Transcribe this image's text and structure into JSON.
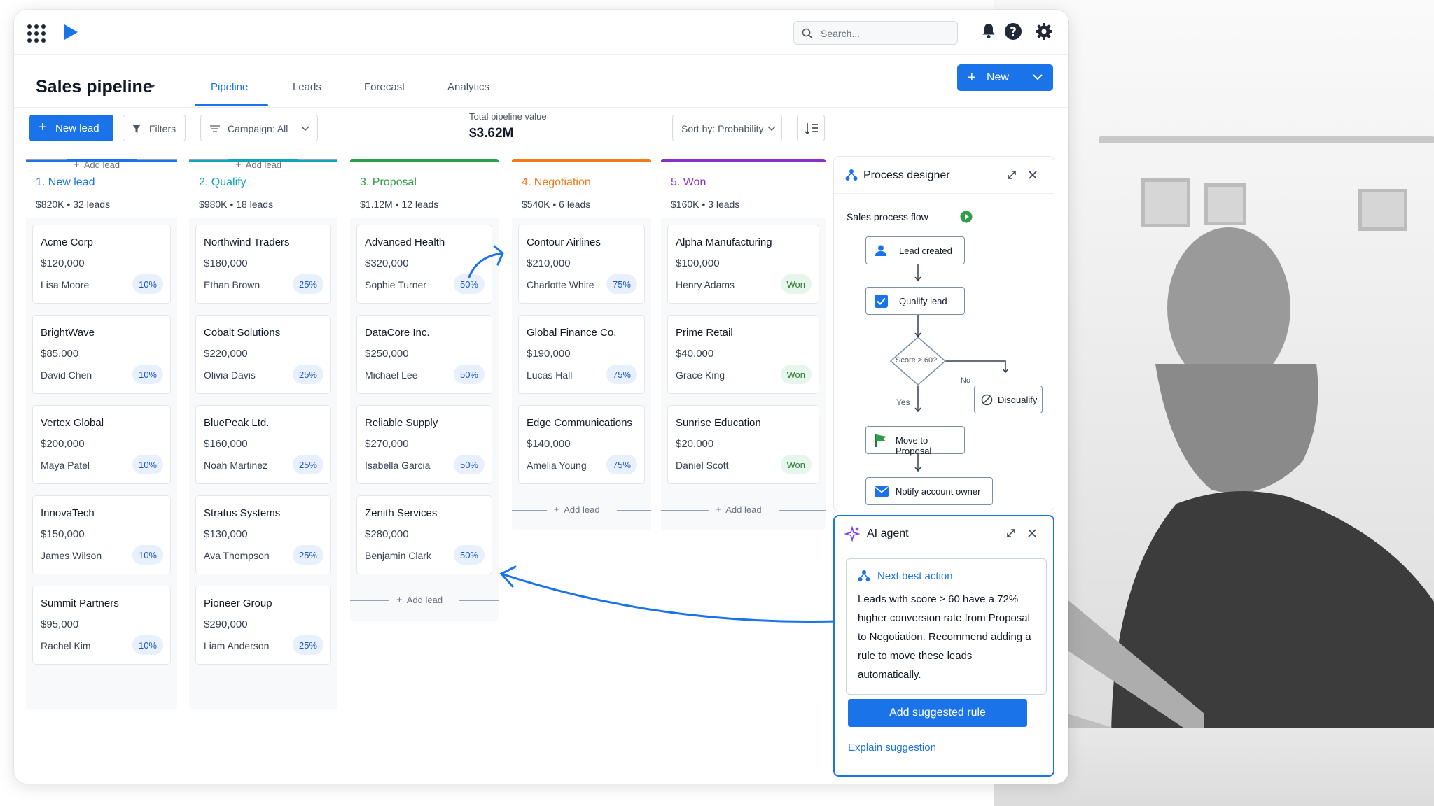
{
  "search": {
    "placeholder": "Search..."
  },
  "header": {
    "title": "Sales pipeline",
    "tabs": [
      {
        "label": "Pipeline",
        "active": true
      },
      {
        "label": "Leads",
        "active": false
      },
      {
        "label": "Forecast",
        "active": false
      },
      {
        "label": "Analytics",
        "active": false
      }
    ],
    "new_button": "New"
  },
  "toolbar": {
    "new_lead": "New lead",
    "filters": "Filters",
    "campaign": "Campaign: All",
    "total_label": "Total pipeline value",
    "total_value": "$3.62M",
    "sort": "Sort by: Probability"
  },
  "columns": [
    {
      "title": "1. New lead",
      "summary": "$820K • 32 leads",
      "color": "#1a73e8",
      "cards": [
        {
          "name": "Acme Corp",
          "value": "$120,000",
          "owner": "Lisa Moore",
          "badge": "10%"
        },
        {
          "name": "BrightWave",
          "value": "$85,000",
          "owner": "David Chen",
          "badge": "10%"
        },
        {
          "name": "Vertex Global",
          "value": "$200,000",
          "owner": "Maya Patel",
          "badge": "10%"
        },
        {
          "name": "InnovaTech",
          "value": "$150,000",
          "owner": "James Wilson",
          "badge": "10%"
        },
        {
          "name": "Summit Partners",
          "value": "$95,000",
          "owner": "Rachel Kim",
          "badge": "10%"
        }
      ],
      "add_label": "Add lead"
    },
    {
      "title": "2. Qualify",
      "summary": "$980K • 18 leads",
      "color": "#0ea5b7",
      "cards": [
        {
          "name": "Northwind Traders",
          "value": "$180,000",
          "owner": "Ethan Brown",
          "badge": "25%"
        },
        {
          "name": "Cobalt Solutions",
          "value": "$220,000",
          "owner": "Olivia Davis",
          "badge": "25%"
        },
        {
          "name": "BluePeak Ltd.",
          "value": "$160,000",
          "owner": "Noah Martinez",
          "badge": "25%"
        },
        {
          "name": "Stratus Systems",
          "value": "$130,000",
          "owner": "Ava Thompson",
          "badge": "25%"
        },
        {
          "name": "Pioneer Group",
          "value": "$290,000",
          "owner": "Liam Anderson",
          "badge": "25%"
        }
      ],
      "add_label": "Add lead"
    },
    {
      "title": "3. Proposal",
      "summary": "$1.12M • 12 leads",
      "color": "#2e9e48",
      "cards": [
        {
          "name": "Advanced Health",
          "value": "$320,000",
          "owner": "Sophie Turner",
          "badge": "50%"
        },
        {
          "name": "DataCore Inc.",
          "value": "$250,000",
          "owner": "Michael Lee",
          "badge": "50%"
        },
        {
          "name": "Reliable Supply",
          "value": "$270,000",
          "owner": "Isabella Garcia",
          "badge": "50%"
        },
        {
          "name": "Zenith Services",
          "value": "$280,000",
          "owner": "Benjamin Clark",
          "badge": "50%"
        }
      ],
      "add_label": "Add lead"
    },
    {
      "title": "4. Negotiation",
      "summary": "$540K • 6 leads",
      "color": "#f27a1a",
      "cards": [
        {
          "name": "Contour Airlines",
          "value": "$210,000",
          "owner": "Charlotte White",
          "badge": "75%"
        },
        {
          "name": "Global Finance Co.",
          "value": "$190,000",
          "owner": "Lucas Hall",
          "badge": "75%"
        },
        {
          "name": "Edge Communications",
          "value": "$140,000",
          "owner": "Amelia Young",
          "badge": "75%"
        }
      ],
      "add_label": "Add lead"
    },
    {
      "title": "5. Won",
      "summary": "$160K • 3 leads",
      "color": "#8b2fc9",
      "cards": [
        {
          "name": "Alpha Manufacturing",
          "value": "$100,000",
          "owner": "Henry Adams",
          "badge": "Won"
        },
        {
          "name": "Prime Retail",
          "value": "$40,000",
          "owner": "Grace King",
          "badge": "Won"
        },
        {
          "name": "Sunrise Education",
          "value": "$20,000",
          "owner": "Daniel Scott",
          "badge": "Won"
        }
      ],
      "add_label": "Add lead"
    }
  ],
  "process": {
    "title": "Process designer",
    "flow_label": "Sales process flow",
    "nodes": {
      "lead_created": "Lead created",
      "qualify": "Qualify lead",
      "decision": "Score ≥ 60?",
      "disqualify": "Disqualify",
      "move": "Move to Proposal",
      "notify": "Notify account owner"
    },
    "yes": "Yes",
    "no": "No"
  },
  "ai": {
    "title": "AI agent",
    "nba_title": "Next best action",
    "nba_text": "Leads with score ≥ 60 have a 72% higher conversion rate from Proposal to Negotiation. Recommend adding a rule to move these leads automatically.",
    "button": "Add suggested rule",
    "link": "Explain suggestion"
  }
}
